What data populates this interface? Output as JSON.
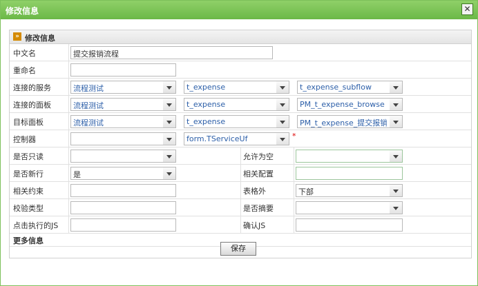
{
  "window": {
    "title": "修改信息",
    "close_icon": "close-icon"
  },
  "section": {
    "title": "修改信息",
    "more_title": "更多信息",
    "badge": "»"
  },
  "fields": {
    "chinese_name": {
      "label": "中文名",
      "value": "提交报销流程"
    },
    "rename": {
      "label": "重命名",
      "value": ""
    },
    "service": {
      "label": "连接的服务",
      "values": [
        "流程测试",
        "t_expense",
        "t_expense_subflow"
      ]
    },
    "panel": {
      "label": "连接的面板",
      "values": [
        "流程测试",
        "t_expense",
        "PM_t_expense_browse"
      ]
    },
    "target_panel": {
      "label": "目标面板",
      "values": [
        "流程测试",
        "t_expense",
        "PM_t_expense_提交报销单"
      ]
    },
    "controller": {
      "label": "控制器",
      "values": [
        "",
        "form.TServiceUf"
      ],
      "required_mark": "*"
    },
    "readonly": {
      "label": "是否只读",
      "value": ""
    },
    "allow_empty": {
      "label": "允许为空",
      "value": ""
    },
    "new_line": {
      "label": "是否新行",
      "value": "是"
    },
    "related_config": {
      "label": "相关配置",
      "value": ""
    },
    "related_constraint": {
      "label": "相关约束",
      "value": ""
    },
    "outside_table": {
      "label": "表格外",
      "value": "下部"
    },
    "check_type": {
      "label": "校验类型",
      "value": ""
    },
    "is_summary": {
      "label": "是否摘要",
      "value": ""
    },
    "click_js": {
      "label": "点击执行的JS",
      "value": ""
    },
    "confirm_js": {
      "label": "确认JS",
      "value": ""
    }
  },
  "buttons": {
    "save": "保存"
  }
}
